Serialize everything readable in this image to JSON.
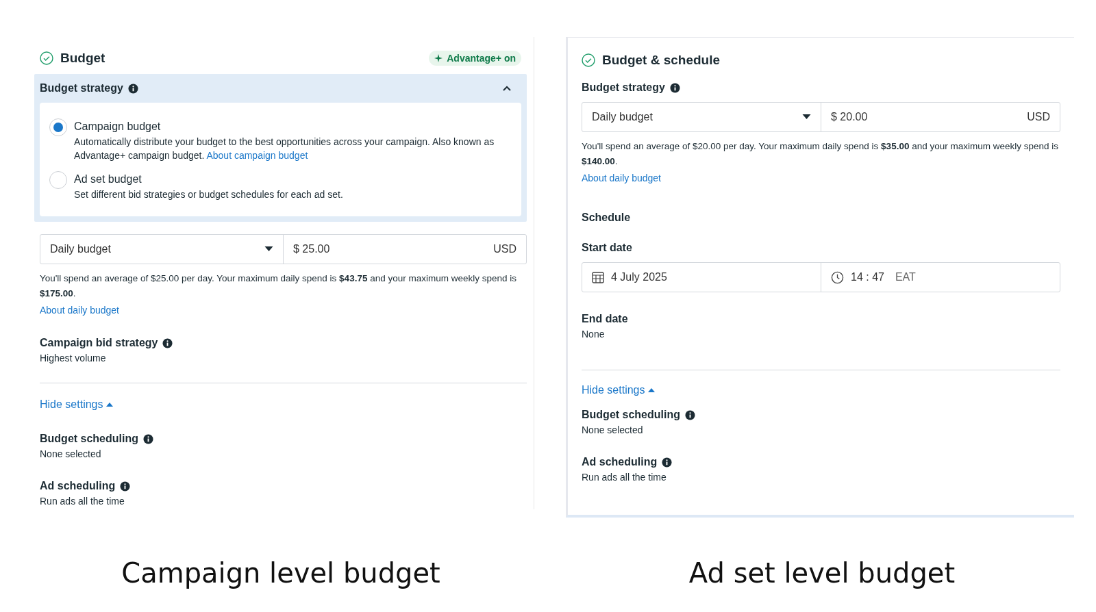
{
  "panels": [
    {
      "title": "Budget",
      "badge": "Advantage+ on",
      "sections": [
        {
          "kind": "strategy_box",
          "title": "Budget strategy",
          "info": true,
          "expanded": true,
          "options": [
            {
              "label": "Campaign budget",
              "description": "Automatically distribute your budget to the best opportunities across your campaign. Also known as Advantage+ campaign budget.",
              "link": "About campaign budget",
              "selected": true
            },
            {
              "label": "Ad set budget",
              "description": "Set different bid strategies or budget schedules for each ad set.",
              "selected": false
            }
          ]
        },
        {
          "kind": "budget_input",
          "type": "Daily budget",
          "amount": "$ 25.00",
          "currency": "USD"
        },
        {
          "kind": "note",
          "text": "You'll spend an average of $25.00 per day. Your maximum daily spend is **$43.75** and your maximum weekly spend is **$175.00**."
        },
        {
          "kind": "link",
          "text": "About daily budget"
        },
        {
          "kind": "field",
          "label": "Campaign bid strategy",
          "value": "Highest volume",
          "info": true
        },
        {
          "kind": "hide_settings",
          "text": "Hide settings"
        },
        {
          "kind": "field",
          "label": "Budget scheduling",
          "value": "None selected",
          "info": true
        },
        {
          "kind": "field",
          "label": "Ad scheduling",
          "value": "Run ads all the time",
          "info": true
        }
      ]
    },
    {
      "title": "Budget & schedule",
      "sections": [
        {
          "kind": "label",
          "text": "Budget strategy",
          "info": true
        },
        {
          "kind": "budget_input",
          "type": "Daily budget",
          "amount": "$ 20.00",
          "currency": "USD"
        },
        {
          "kind": "note",
          "text": "You'll spend an average of $20.00 per day. Your maximum daily spend is **$35.00** and your maximum weekly spend is **$140.00**."
        },
        {
          "kind": "link",
          "text": "About daily budget"
        },
        {
          "kind": "heading",
          "text": "Schedule"
        },
        {
          "kind": "label",
          "text": "Start date",
          "info": false
        },
        {
          "kind": "date_time",
          "date": "4 July 2025",
          "time": "14 : 47",
          "zone": "EAT"
        },
        {
          "kind": "field",
          "label": "End date",
          "value": "None",
          "info": false
        },
        {
          "kind": "hide_settings",
          "text": "Hide settings"
        },
        {
          "kind": "field",
          "label": "Budget scheduling",
          "value": "None selected",
          "info": true
        },
        {
          "kind": "field",
          "label": "Ad scheduling",
          "value": "Run ads all the time",
          "info": true
        }
      ]
    }
  ],
  "captions": [
    "Campaign level budget",
    "Ad set level budget"
  ]
}
